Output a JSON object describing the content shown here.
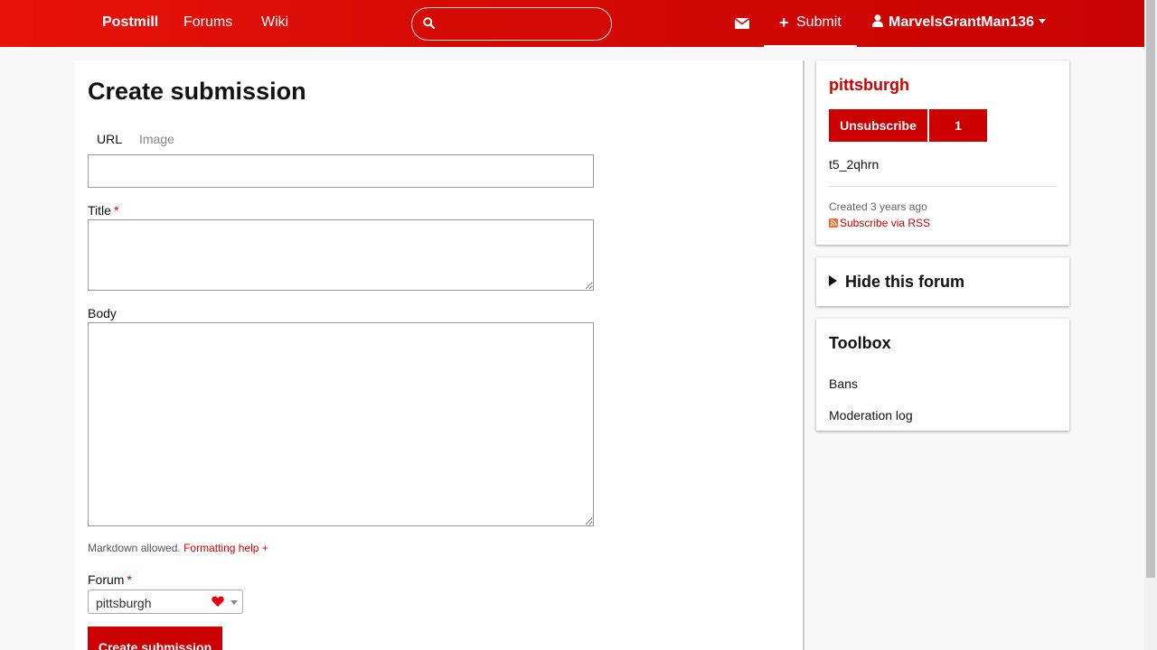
{
  "nav": {
    "brand": "Postmill",
    "links": [
      "Forums",
      "Wiki"
    ],
    "search_value": "",
    "submit_label": "Submit",
    "username": "MarvelsGrantMan136"
  },
  "form": {
    "title": "Create submission",
    "tabs": [
      "URL",
      "Image"
    ],
    "active_tab": "URL",
    "url_value": "",
    "title_label": "Title",
    "title_value": "",
    "body_label": "Body",
    "body_value": "",
    "required_marker": "*",
    "markdown_note": "Markdown allowed.",
    "formatting_help": "Formatting help +",
    "forum_label": "Forum",
    "forum_value": "pittsburgh",
    "submit_button": "Create submission"
  },
  "sidebar": {
    "forum_name": "pittsburgh",
    "unsubscribe_label": "Unsubscribe",
    "subscriber_count": "1",
    "forum_id": "t5_2qhrn",
    "created_prefix": "Created",
    "created_ago": "3 years ago",
    "rss_label": "Subscribe via RSS",
    "hide_forum_label": "Hide this forum",
    "toolbox_title": "Toolbox",
    "toolbox_links": [
      "Bans",
      "Moderation log"
    ]
  },
  "colors": {
    "accent": "#cc0000",
    "nav_bg": "#d40a05"
  }
}
